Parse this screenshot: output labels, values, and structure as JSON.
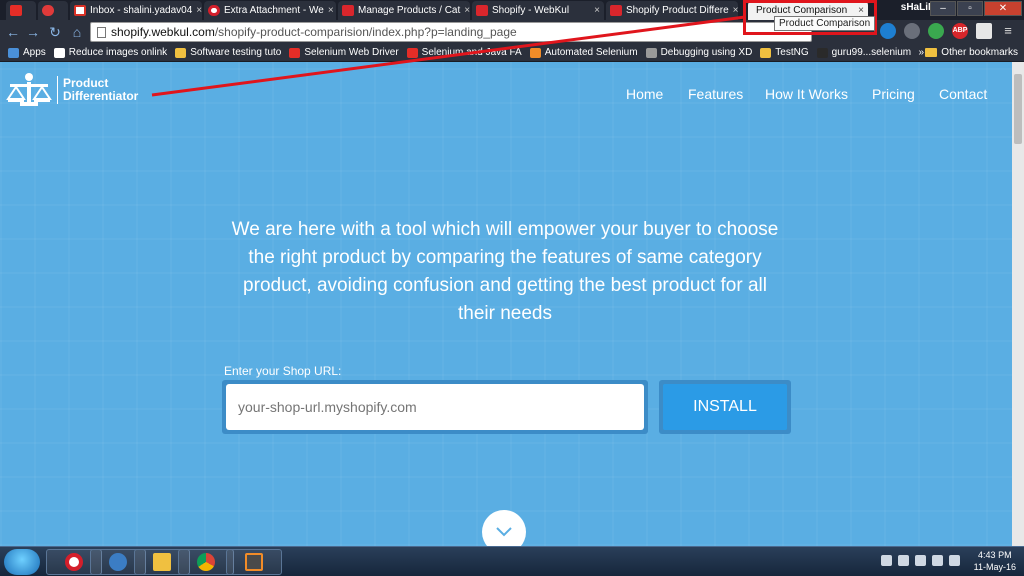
{
  "browser": {
    "tabs": [
      {
        "label": "",
        "favicon": "youtube-icon",
        "active": false
      },
      {
        "label": "",
        "favicon": "chat-icon",
        "active": false
      },
      {
        "label": "Inbox - shalini.yadav04",
        "favicon": "gmail-icon",
        "active": false
      },
      {
        "label": "Extra Attachment - We",
        "favicon": "opera-icon",
        "active": false
      },
      {
        "label": "Manage Products / Cat",
        "favicon": "webkul-icon",
        "active": false
      },
      {
        "label": "Shopify - WebKul",
        "favicon": "webkul-icon",
        "active": false
      },
      {
        "label": "Shopify Product Differe",
        "favicon": "webkul-icon",
        "active": false
      },
      {
        "label": "Product Comparison",
        "favicon": "",
        "active": true
      }
    ],
    "tab_close_glyph": "×",
    "tooltip": "Product Comparison",
    "user": "sHaLiNi",
    "url_host": "shopify.webkul.com",
    "url_path": "/shopify-product-comparision/index.php?p=landing_page",
    "bookmarks": [
      {
        "label": "Apps",
        "color": "#4a90d9"
      },
      {
        "label": "Reduce images onlink",
        "color": "#ffffff"
      },
      {
        "label": "Software testing tuto",
        "color": "#f0c040"
      },
      {
        "label": "Selenium Web Driver",
        "color": "#e52d27"
      },
      {
        "label": "Selenium and Java FA",
        "color": "#e52d27"
      },
      {
        "label": "Automated Selenium",
        "color": "#f28c28"
      },
      {
        "label": "Debugging using XD",
        "color": "#9a9a9a"
      },
      {
        "label": "TestNG",
        "color": "#f0c040"
      },
      {
        "label": "guru99...selenium",
        "color": "#2a2a2a"
      }
    ],
    "bookmarks_overflow": "»",
    "other_bookmarks": "Other bookmarks",
    "ext_abp": "ABP"
  },
  "site": {
    "brand": {
      "line1": "Product",
      "line2": "Differentiator"
    },
    "nav": [
      "Home",
      "Features",
      "How It Works",
      "Pricing",
      "Contact"
    ],
    "hero_text": "We are here with a tool which will empower your buyer to choose the right product by comparing the features of same category product, avoiding confusion and getting the best product for all their needs",
    "shop_label": "Enter your Shop URL:",
    "shop_placeholder": "your-shop-url.myshopify.com",
    "install_label": "INSTALL"
  },
  "taskbar": {
    "time": "4:43 PM",
    "date": "11-May-16"
  },
  "colors": {
    "page_bg": "#5aaee3",
    "install_bg": "#2b9be6",
    "annotation": "#e0151c"
  }
}
